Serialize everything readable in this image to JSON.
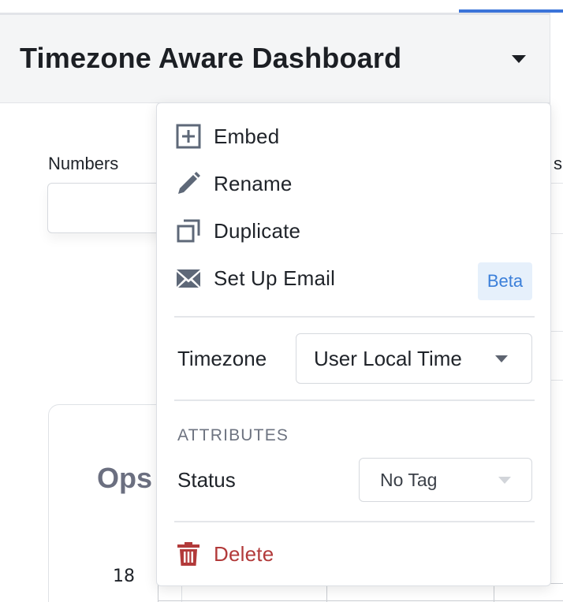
{
  "dashboard": {
    "title": "Timezone Aware Dashboard"
  },
  "filters": {
    "numbers_label": "Numbers",
    "right_label_fragment": "s"
  },
  "card": {
    "title_fragment": "Ops",
    "y_tick": "18"
  },
  "menu": {
    "items": [
      {
        "label": "Embed",
        "icon": "embed-plus-icon"
      },
      {
        "label": "Rename",
        "icon": "pencil-icon"
      },
      {
        "label": "Duplicate",
        "icon": "duplicate-icon"
      },
      {
        "label": "Set Up Email",
        "icon": "envelope-icon",
        "badge": "Beta"
      }
    ],
    "timezone": {
      "label": "Timezone",
      "value": "User Local Time"
    },
    "attributes": {
      "heading": "ATTRIBUTES",
      "status_label": "Status",
      "status_value": "No Tag"
    },
    "delete": {
      "label": "Delete",
      "icon": "trash-icon"
    }
  },
  "colors": {
    "accent": "#3b74d9",
    "danger": "#b23a3a",
    "beta_bg": "#e6f0fb",
    "beta_text": "#3b7fd9",
    "icon": "#5e6878"
  }
}
